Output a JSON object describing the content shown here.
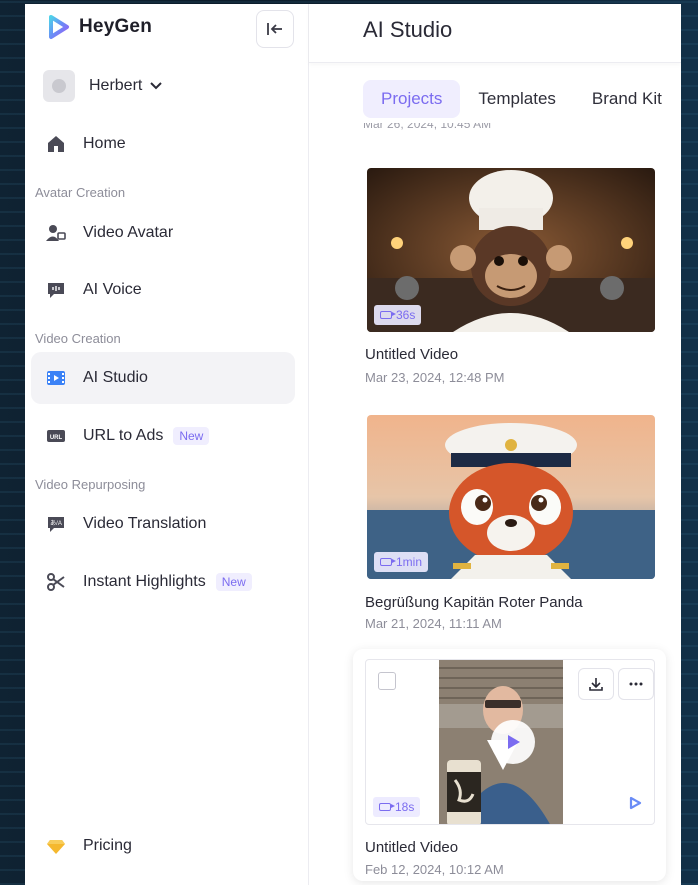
{
  "app": {
    "name": "HeyGen"
  },
  "user": {
    "name": "Herbert"
  },
  "sidebar": {
    "home": "Home",
    "sections": {
      "avatar": "Avatar Creation",
      "video": "Video Creation",
      "repurpose": "Video Repurposing"
    },
    "items": {
      "video_avatar": "Video Avatar",
      "ai_voice": "AI Voice",
      "ai_studio": "AI Studio",
      "url_to_ads": "URL to Ads",
      "video_translation": "Video Translation",
      "instant_highlights": "Instant Highlights"
    },
    "new_badge": "New",
    "pricing": "Pricing"
  },
  "main": {
    "title": "AI Studio",
    "tabs": [
      "Projects",
      "Templates",
      "Brand Kit"
    ],
    "active_tab": 0,
    "cutoff_date": "Mar 26, 2024, 10:45 AM",
    "videos": [
      {
        "duration": "36s",
        "title": "Untitled Video",
        "date": "Mar 23, 2024, 12:48 PM"
      },
      {
        "duration": "1min",
        "title": "Begrüßung Kapitän Roter Panda",
        "date": "Mar 21, 2024, 11:11 AM"
      },
      {
        "duration": "18s",
        "title": "Untitled Video",
        "date": "Feb 12, 2024, 10:12 AM"
      }
    ]
  },
  "colors": {
    "accent": "#7b6cf0",
    "accent_bg": "#f0eefe",
    "text": "#2a2a36",
    "muted": "#8d8d99"
  },
  "icons": {
    "collapse": "collapse-left-icon",
    "download": "download-icon",
    "more": "more-horizontal-icon",
    "play": "play-icon"
  }
}
